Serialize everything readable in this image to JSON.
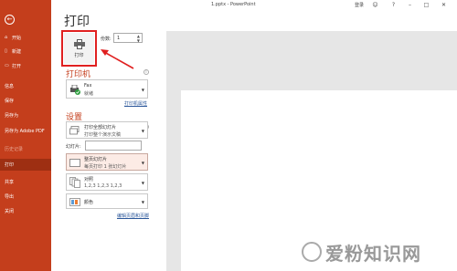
{
  "window": {
    "title": "1.pptx  -  PowerPoint",
    "user": "登录"
  },
  "sidebar": {
    "items": [
      {
        "label": "开始"
      },
      {
        "label": "新建"
      },
      {
        "label": "打开"
      },
      {
        "label": "信息"
      },
      {
        "label": "保存"
      },
      {
        "label": "另存为"
      },
      {
        "label": "另存为 Adobe PDF"
      },
      {
        "label": "历史记录"
      },
      {
        "label": "打印"
      },
      {
        "label": "共享"
      },
      {
        "label": "导出"
      },
      {
        "label": "关闭"
      }
    ]
  },
  "main": {
    "heading": "打印",
    "print_button_label": "打印",
    "copies_label": "份数:",
    "copies_value": "1",
    "printer_section": "打印机",
    "printer_name": "Fax",
    "printer_status": "就绪",
    "printer_properties_link": "打印机属性",
    "settings_section": "设置",
    "range_line1": "打印全部幻灯片",
    "range_line2": "打印整个演示文稿",
    "slides_label": "幻灯片:",
    "layout_line1": "整页幻灯片",
    "layout_line2": "每页打印 1 张幻灯片",
    "collate_line1": "对照",
    "collate_line2": "1,2,3    1,2,3    1,2,3",
    "color_line1": "颜色",
    "edit_header_link": "编辑页眉和页脚"
  },
  "watermark": "爱粉知识网"
}
